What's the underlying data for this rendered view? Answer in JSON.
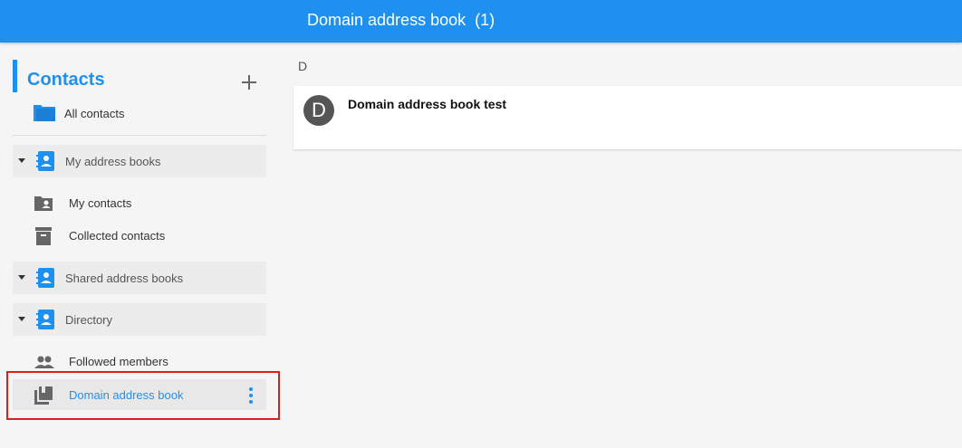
{
  "header": {
    "title": "Domain address book  (1)"
  },
  "sidebar": {
    "heading": "Contacts",
    "all_contacts": "All contacts",
    "groups": [
      {
        "label": "My address books",
        "items": [
          "My contacts",
          "Collected contacts"
        ]
      },
      {
        "label": "Shared address books",
        "items": []
      },
      {
        "label": "Directory",
        "items": [
          "Followed members",
          "Domain address book"
        ]
      }
    ],
    "selected_item": "Domain address book"
  },
  "main": {
    "section_letter": "D",
    "contacts": [
      {
        "initial": "D",
        "name": "Domain address book test"
      }
    ]
  },
  "colors": {
    "accent": "#1e90f0",
    "highlight": "#e31b1b",
    "avatar": "#555555"
  },
  "icons": [
    "add-icon",
    "folder-icon",
    "address-book-icon",
    "folder-person-icon",
    "archive-icon",
    "people-icon",
    "book-icon",
    "more-vert-icon",
    "caret-down-icon"
  ]
}
